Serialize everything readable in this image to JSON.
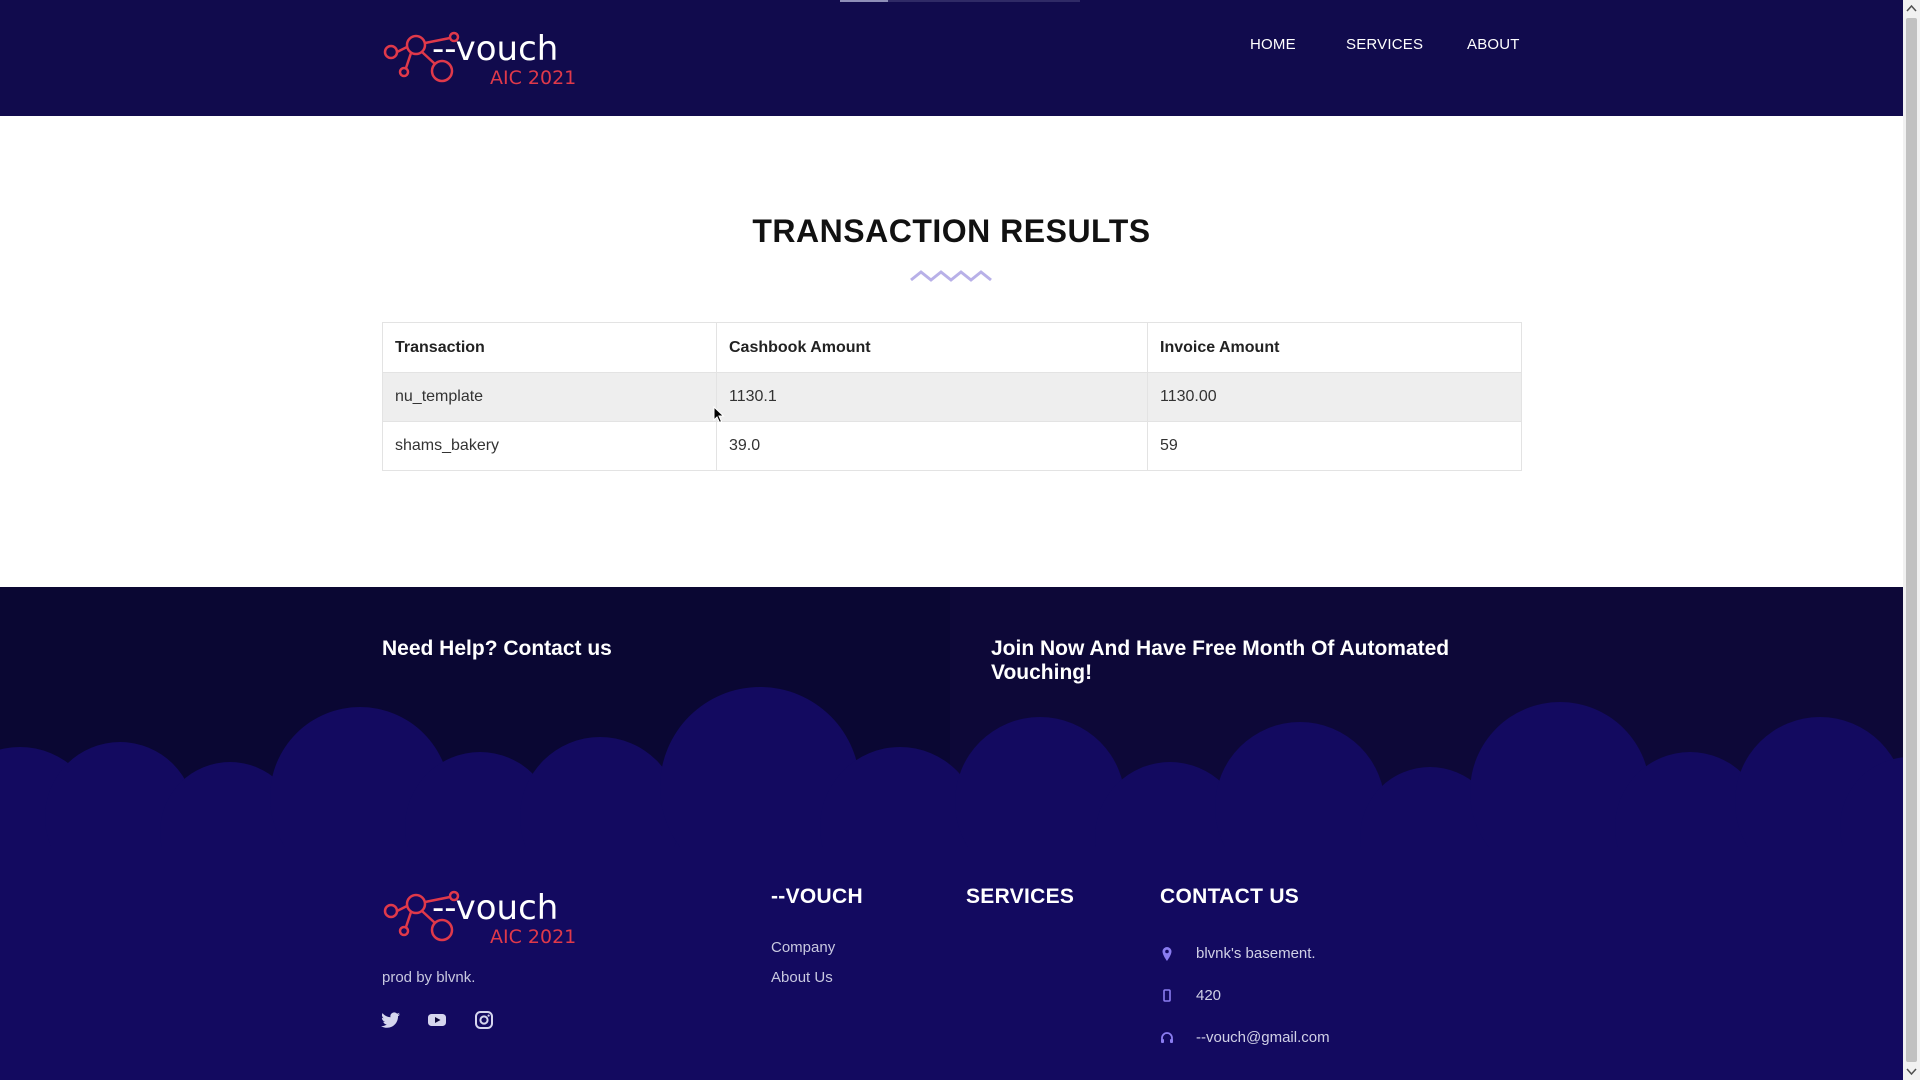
{
  "header": {
    "logo": {
      "wordmark": "--vouch",
      "tagline": "AIC 2021",
      "icon": "network-nodes-icon"
    },
    "nav": [
      {
        "label": "HOME"
      },
      {
        "label": "SERVICES"
      },
      {
        "label": "ABOUT"
      }
    ]
  },
  "main": {
    "title": "TRANSACTION RESULTS",
    "table": {
      "columns": [
        "Transaction",
        "Cashbook Amount",
        "Invoice Amount"
      ],
      "rows": [
        [
          "nu_template",
          "1130.1",
          "1130.00"
        ],
        [
          "shams_bakery",
          "39.0",
          "59"
        ]
      ]
    }
  },
  "footer": {
    "help_heading": "Need Help? Contact us",
    "join_heading": "Join Now And Have Free Month Of Automated Vouching!",
    "logo": {
      "wordmark": "--vouch",
      "tagline": "AIC 2021"
    },
    "prod": "prod by blvnk.",
    "social": [
      {
        "icon": "twitter-icon"
      },
      {
        "icon": "youtube-icon"
      },
      {
        "icon": "instagram-icon"
      }
    ],
    "columns": {
      "vouch": {
        "title": "--VOUCH",
        "links": [
          "Company",
          "About Us"
        ]
      },
      "services": {
        "title": "SERVICES"
      },
      "contact": {
        "title": "CONTACT US",
        "items": [
          {
            "icon": "map-pin-icon",
            "text": "blvnk's basement."
          },
          {
            "icon": "phone-icon",
            "text": "420"
          },
          {
            "icon": "headset-icon",
            "text": "--vouch@gmail.com"
          }
        ]
      }
    }
  },
  "colors": {
    "header_bg": "#110b4d",
    "footer_bg": "#0d0838",
    "accent_red": "#e0394a",
    "accent_purple": "#8a7cf0"
  }
}
